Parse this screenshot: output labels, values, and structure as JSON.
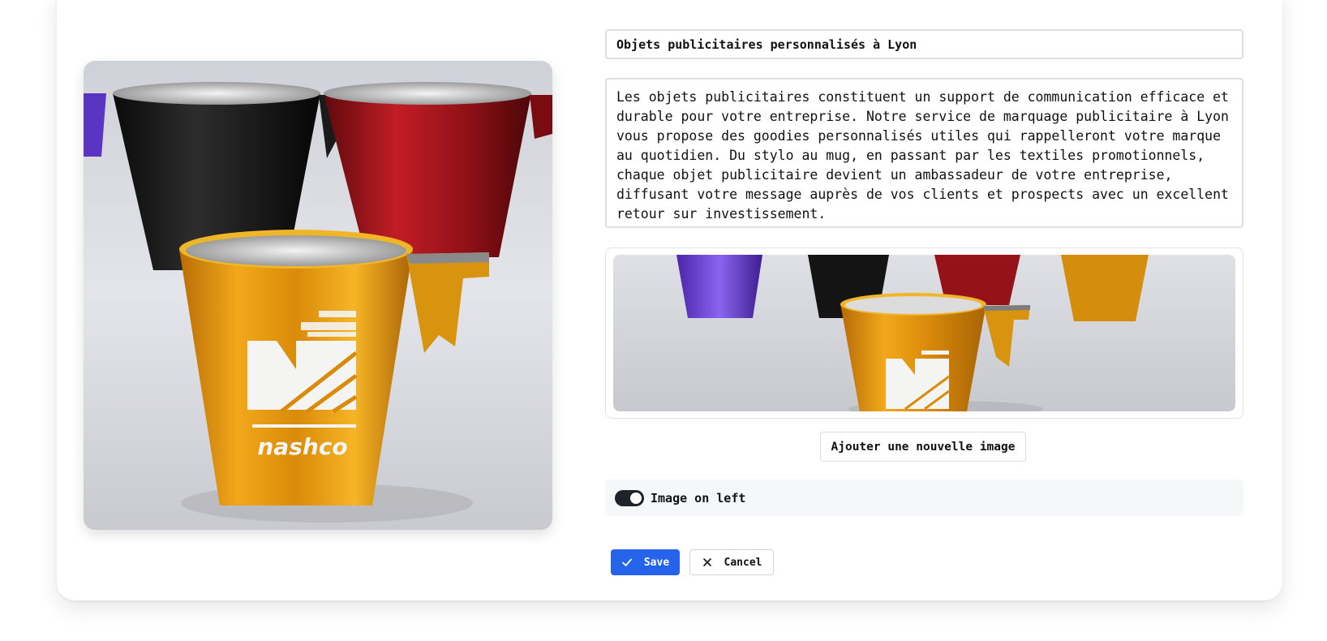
{
  "editor": {
    "title_value": "Objets publicitaires personnalisés à Lyon",
    "description_value": "Les objets publicitaires constituent un support de communication efficace et durable pour votre entreprise. Notre service de marquage publicitaire à Lyon vous propose des goodies personnalisés utiles qui rappelleront votre marque au quotidien. Du stylo au mug, en passant par les textiles promotionnels, chaque objet publicitaire devient un ambassadeur de votre entreprise, diffusant votre message auprès de vos clients et prospects avec un excellent retour sur investissement.",
    "add_image_label": "Ajouter une nouvelle image",
    "image_on_left_label": "Image on left",
    "image_on_left": true,
    "save_label": "Save",
    "cancel_label": "Cancel"
  },
  "main_image": {
    "brand_text": "nashco",
    "icon": "mug-photo"
  },
  "thumbnail": {
    "icon": "mug-photo-thumbnail"
  },
  "colors": {
    "primary": "#2563eb",
    "toggle_on": "#1f2329",
    "mug_gold": "#e69a12",
    "mug_red": "#a8141c",
    "mug_black": "#141414",
    "mug_purple": "#6f4bd8"
  }
}
